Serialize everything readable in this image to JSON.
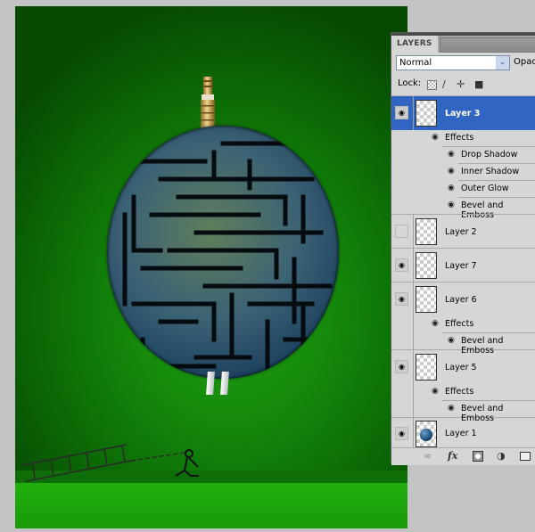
{
  "canvas": {
    "description": "Maze globe with valve stem on green background, figure pulling a ladder",
    "colors": {
      "bg_dark": "#064a02",
      "bg_light": "#1f9b13",
      "ground": "#22b00e"
    }
  },
  "layers_panel": {
    "tab_label": "LAYERS",
    "blend_mode": "Normal",
    "opacity_label": "Opac",
    "lock_label": "Lock:",
    "lock_icons": [
      "lock-transparent-icon",
      "lock-image-icon",
      "lock-position-icon",
      "lock-all-icon"
    ],
    "selected_color": "#3065c2",
    "layers": [
      {
        "name": "Layer 3",
        "visible": true,
        "selected": true,
        "effects_label": "Effects",
        "effects": [
          "Drop Shadow",
          "Inner Shadow",
          "Outer Glow",
          "Bevel and Emboss"
        ]
      },
      {
        "name": "Layer 2",
        "visible": false,
        "selected": false
      },
      {
        "name": "Layer 7",
        "visible": true,
        "selected": false
      },
      {
        "name": "Layer 6",
        "visible": true,
        "selected": false,
        "effects_label": "Effects",
        "effects": [
          "Bevel and Emboss"
        ]
      },
      {
        "name": "Layer 5",
        "visible": true,
        "selected": false,
        "effects_label": "Effects",
        "effects": [
          "Bevel and Emboss"
        ]
      },
      {
        "name": "Layer 1",
        "visible": true,
        "selected": false
      }
    ],
    "bottom_icons": [
      "link-layers-icon",
      "fx-icon",
      "layer-mask-icon",
      "adjustment-layer-icon",
      "new-group-icon"
    ],
    "fx_text": "fx"
  }
}
